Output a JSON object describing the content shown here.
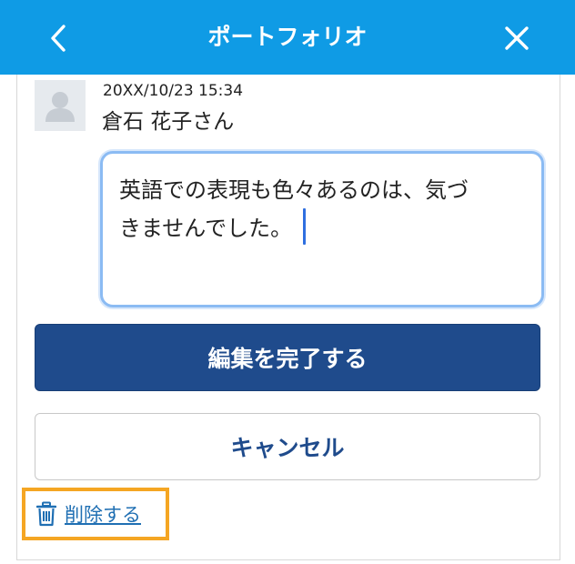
{
  "header": {
    "title": "ポートフォリオ",
    "back_icon": "chevron-left-icon",
    "close_icon": "close-icon",
    "background": "#0f9be5"
  },
  "comment": {
    "timestamp": "20XX/10/23 15:34",
    "author": "倉石  花子さん",
    "text_line1": "英語での表現も色々あるのは、気づ",
    "text_line2": "きませんでした。",
    "avatar_icon": "user-silhouette-icon"
  },
  "actions": {
    "complete_label": "編集を完了する",
    "cancel_label": "キャンセル",
    "delete_label": "削除する",
    "delete_icon": "trash-icon",
    "primary_color": "#1f4b8c",
    "highlight_color": "#f5a623"
  }
}
